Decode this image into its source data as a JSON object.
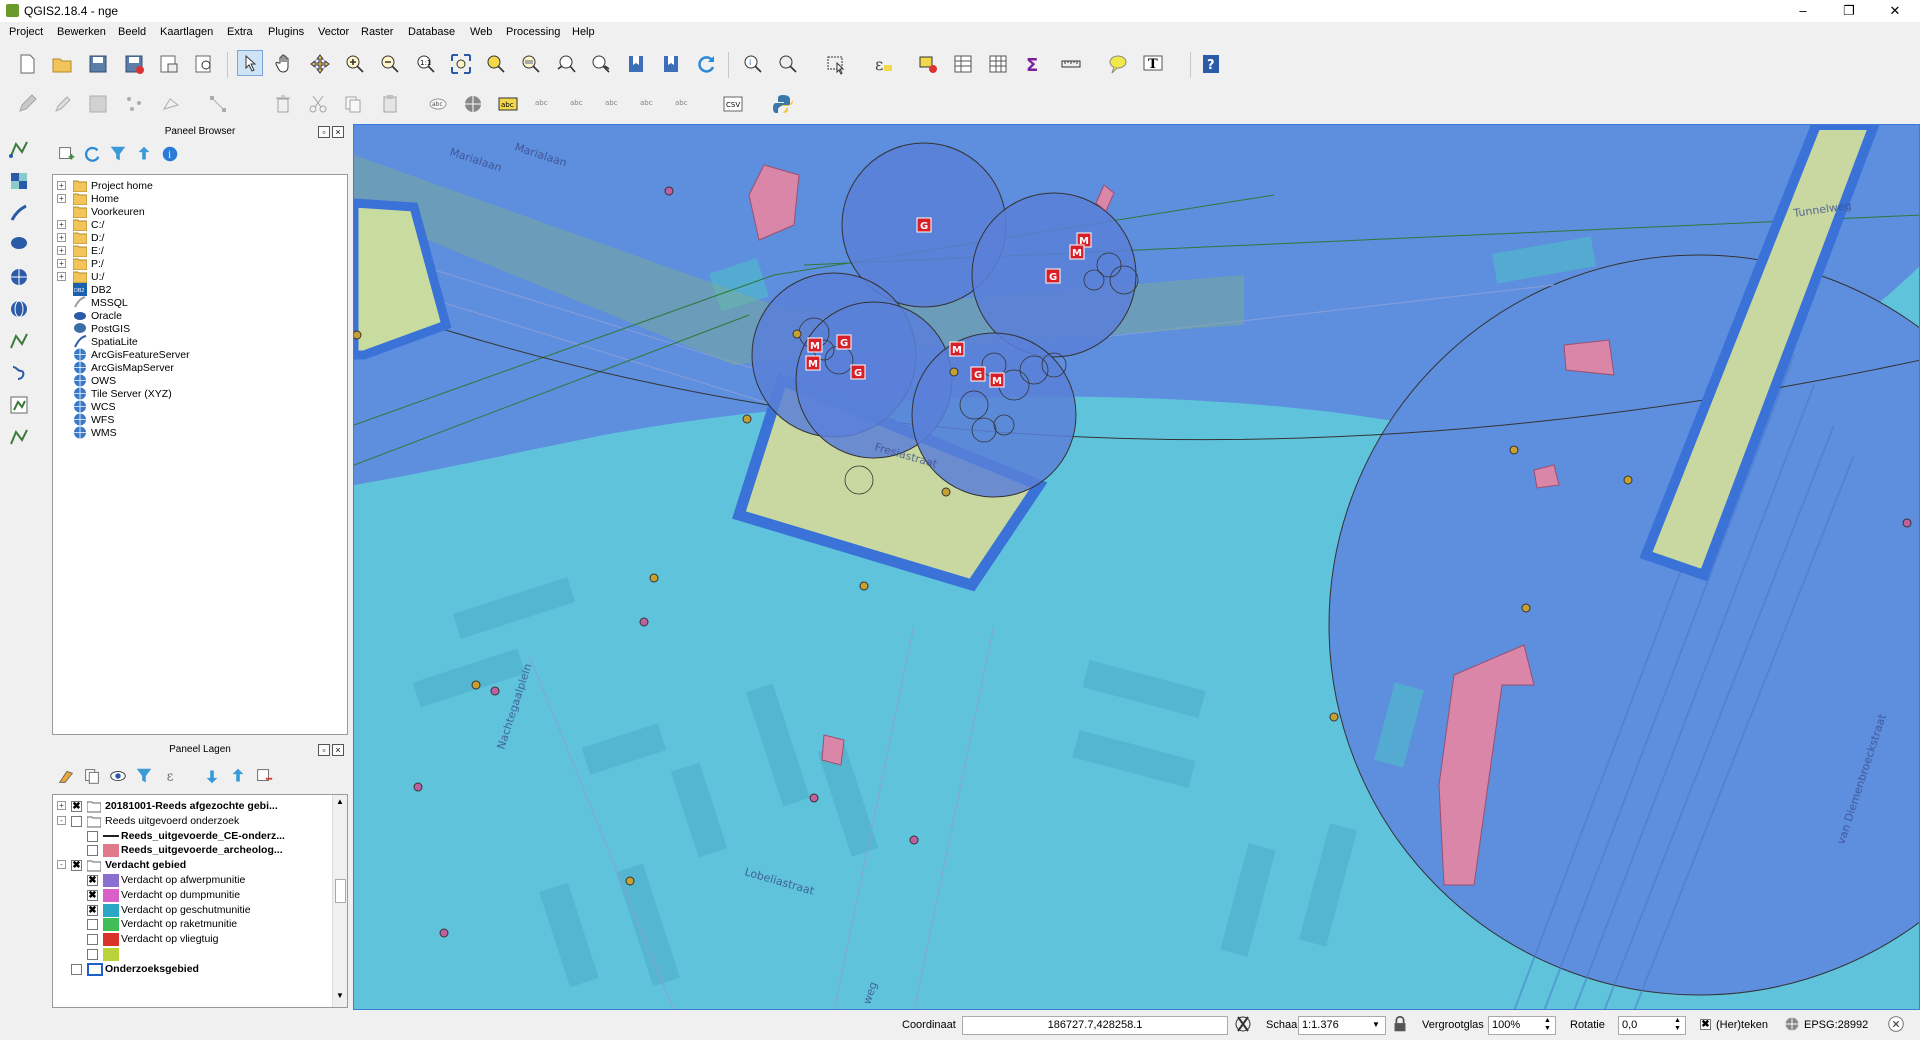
{
  "window": {
    "title": "QGIS2.18.4 - nge",
    "minimize": "–",
    "maximize": "❐",
    "close": "✕"
  },
  "menu": [
    "Project",
    "Bewerken",
    "Beeld",
    "Kaartlagen",
    "Extra",
    "Plugins",
    "Vector",
    "Raster",
    "Database",
    "Web",
    "Processing",
    "Help"
  ],
  "browser_panel": {
    "title": "Paneel Browser",
    "items": [
      {
        "label": "Project home",
        "icon": "folder-icon",
        "expand": true
      },
      {
        "label": "Home",
        "icon": "folder-icon",
        "expand": true
      },
      {
        "label": "Voorkeuren",
        "icon": "folder-icon",
        "expand": false
      },
      {
        "label": "C:/",
        "icon": "folder-icon",
        "expand": true
      },
      {
        "label": "D:/",
        "icon": "folder-icon",
        "expand": true
      },
      {
        "label": "E:/",
        "icon": "folder-icon",
        "expand": true
      },
      {
        "label": "P:/",
        "icon": "folder-icon",
        "expand": true
      },
      {
        "label": "U:/",
        "icon": "folder-icon",
        "expand": true
      },
      {
        "label": "DB2",
        "icon": "db2-icon",
        "expand": false
      },
      {
        "label": "MSSQL",
        "icon": "mssql-icon",
        "expand": false
      },
      {
        "label": "Oracle",
        "icon": "oracle-icon",
        "expand": false
      },
      {
        "label": "PostGIS",
        "icon": "postgis-icon",
        "expand": false
      },
      {
        "label": "SpatiaLite",
        "icon": "spatialite-icon",
        "expand": false
      },
      {
        "label": "ArcGisFeatureServer",
        "icon": "globe-icon",
        "expand": false
      },
      {
        "label": "ArcGisMapServer",
        "icon": "globe-icon",
        "expand": false
      },
      {
        "label": "OWS",
        "icon": "globe-icon",
        "expand": false
      },
      {
        "label": "Tile Server (XYZ)",
        "icon": "globe-icon",
        "expand": false
      },
      {
        "label": "WCS",
        "icon": "globe-icon",
        "expand": false
      },
      {
        "label": "WFS",
        "icon": "globe-icon",
        "expand": false
      },
      {
        "label": "WMS",
        "icon": "globe-icon",
        "expand": false
      }
    ]
  },
  "layers_panel": {
    "title": "Paneel Lagen",
    "rows": [
      {
        "label": "20181001-Reeds afgezochte gebi...",
        "bold": true,
        "checked": true,
        "indent": 0,
        "expand": "+",
        "type": "group"
      },
      {
        "label": "Reeds uitgevoerd onderzoek",
        "bold": false,
        "checked": false,
        "indent": 0,
        "expand": "-",
        "type": "group"
      },
      {
        "label": "Reeds_uitgevoerde_CE-onderz...",
        "bold": true,
        "checked": false,
        "indent": 1,
        "type": "line",
        "color": "#222222"
      },
      {
        "label": "Reeds_uitgevoerde_archeolog...",
        "bold": true,
        "checked": false,
        "indent": 1,
        "type": "fill",
        "color": "#e07a88"
      },
      {
        "label": "Verdacht gebied",
        "bold": true,
        "checked": true,
        "indent": 0,
        "expand": "-",
        "type": "group"
      },
      {
        "label": "Verdacht op afwerpmunitie",
        "bold": false,
        "checked": true,
        "indent": 2,
        "type": "fill",
        "color": "#8a6fd0"
      },
      {
        "label": "Verdacht op dumpmunitie",
        "bold": false,
        "checked": true,
        "indent": 2,
        "type": "fill",
        "color": "#d860c8"
      },
      {
        "label": "Verdacht op geschutmunitie",
        "bold": false,
        "checked": true,
        "indent": 2,
        "type": "fill",
        "color": "#29a7c7"
      },
      {
        "label": "Verdacht op raketmunitie",
        "bold": false,
        "checked": false,
        "indent": 2,
        "type": "fill",
        "color": "#3fbd56"
      },
      {
        "label": "Verdacht op vliegtuig",
        "bold": false,
        "checked": false,
        "indent": 2,
        "type": "fill",
        "color": "#d8342a"
      },
      {
        "label": "",
        "bold": false,
        "checked": false,
        "indent": 2,
        "type": "fill",
        "color": "#b8d43a"
      },
      {
        "label": "Onderzoeksgebied",
        "bold": true,
        "checked": false,
        "indent": 0,
        "type": "outline",
        "color": "#1f5fc8"
      }
    ]
  },
  "map": {
    "street_labels": [
      "Marialaan",
      "Marialaan",
      "Fresiastraat",
      "Nachtegaalplein",
      "Lobeliastraat",
      "Tunnelweg",
      "van Diemenbroeckstraat",
      "weg"
    ],
    "marker_letters": {
      "g": "G",
      "m": "M"
    }
  },
  "statusbar": {
    "coord_label": "Coordinaat",
    "coord_value": "186727.7,428258.1",
    "scale_label": "Schaal",
    "scale_value": "1:1.376",
    "magnifier_label": "Vergrootglas",
    "magnifier_value": "100%",
    "rotation_label": "Rotatie",
    "rotation_value": "0,0",
    "render_label": "(Her)teken",
    "crs_label": "EPSG:28992"
  }
}
